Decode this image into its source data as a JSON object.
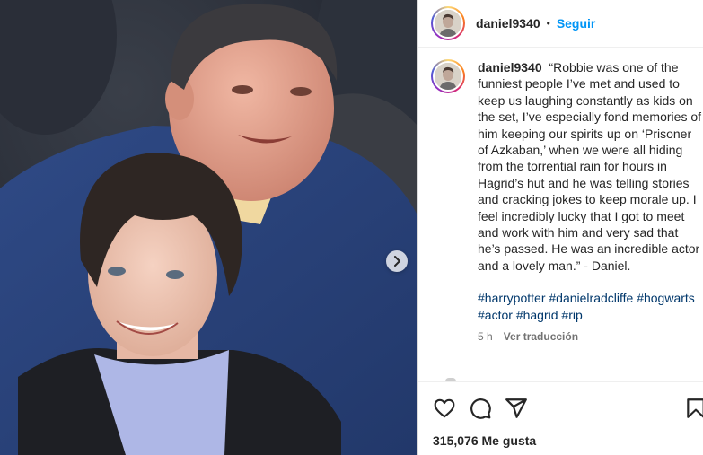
{
  "post": {
    "username": "daniel9340",
    "follow_separator": "•",
    "follow_label": "Seguir",
    "caption_username": "daniel9340",
    "caption_text": "“Robbie was one of the funniest people I’ve met and used to keep us laughing constantly as kids on the set, I’ve especially fond memories of him keeping our spirits up on ‘Prisoner of Azkaban,’ when we were all hiding from the torrential rain for hours in Hagrid’s hut and he was telling stories and cracking jokes to keep morale up. I feel incredibly lucky that I got to meet and work with him and very sad that he’s passed. He was an incredible actor and a lovely man.” - Daniel.",
    "hashtags": [
      "#harrypotter",
      "#danielradcliffe",
      "#hogwarts",
      "#actor",
      "#hagrid",
      "#rip"
    ],
    "time_ago": "5 h",
    "translate_label": "Ver traducción",
    "likes_label": "315,076 Me gusta"
  },
  "icons": {
    "next": "chevron-right-icon",
    "like": "heart-icon",
    "comment": "comment-icon",
    "share": "paper-plane-icon",
    "save": "bookmark-icon"
  },
  "colors": {
    "accent": "#0095f6",
    "hashtag": "#00376b",
    "muted": "#737373",
    "text": "#262626"
  }
}
